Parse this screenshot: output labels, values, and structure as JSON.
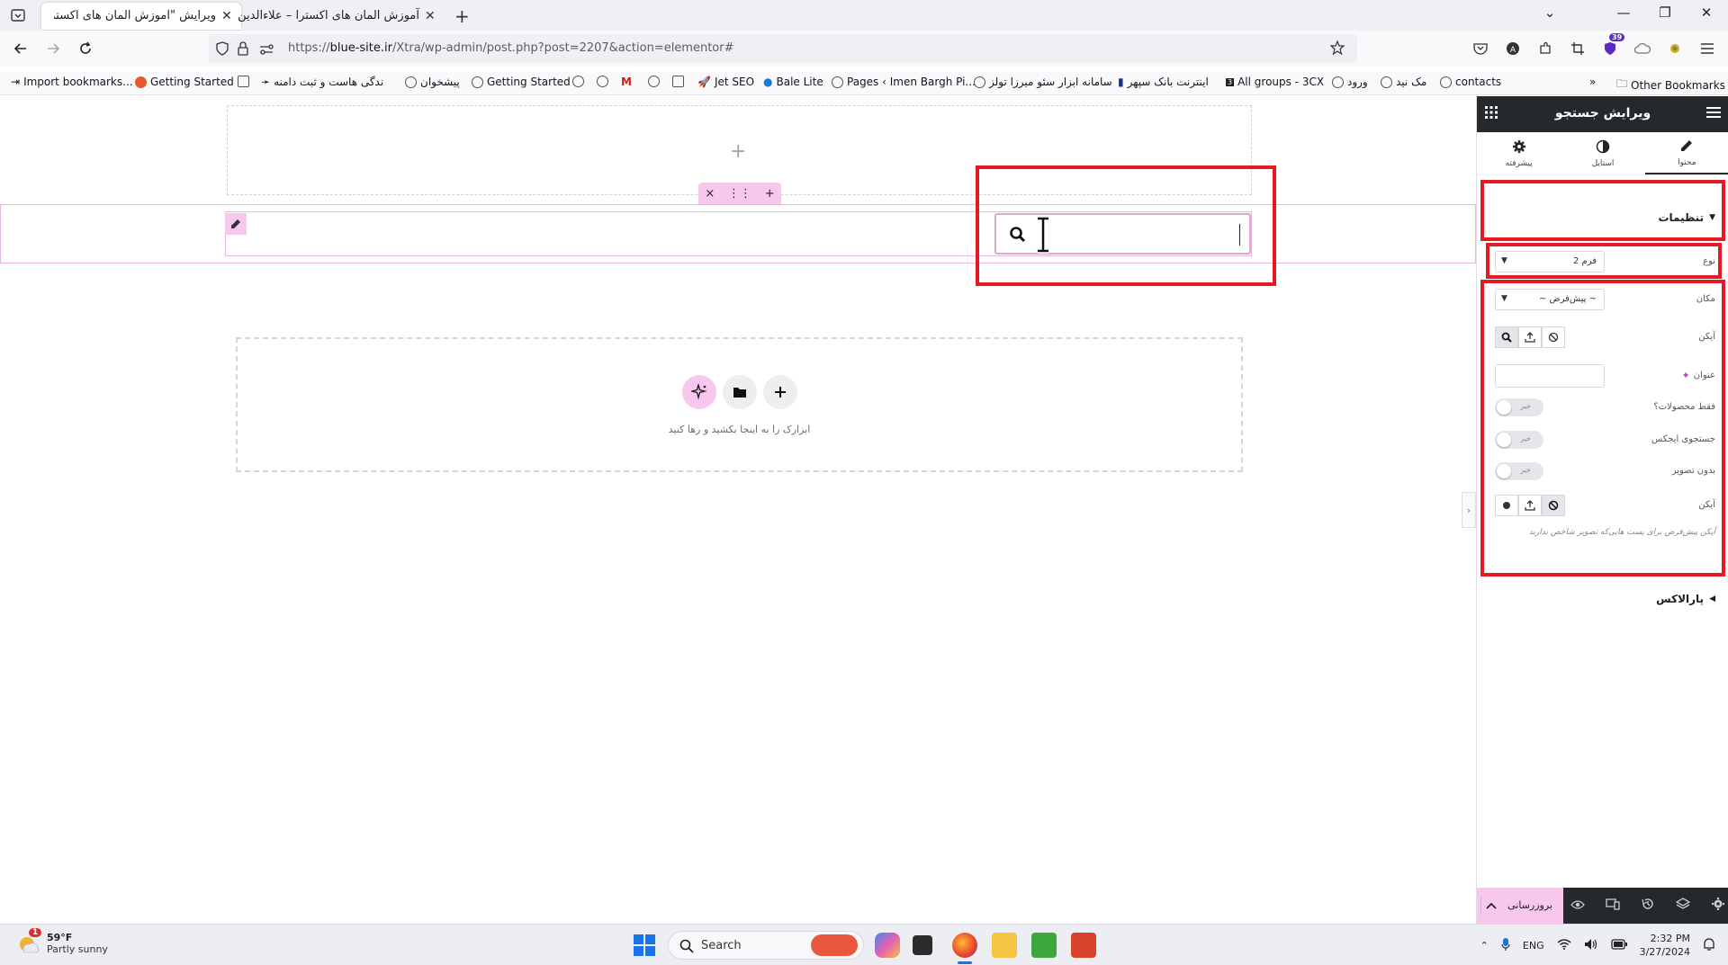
{
  "browser": {
    "tabs": [
      {
        "label": "ویرایش \"آموزش المان های اکسترا\" ‹ ع…",
        "active": true
      },
      {
        "label": "آموزش المان های اکسترا – علاءالدین",
        "active": false
      }
    ],
    "url_scheme": "https://",
    "url_host": "blue-site.ir",
    "url_path": "/Xtra/wp-admin/post.php?post=2207&action=elementor#",
    "extensions_badge": "39",
    "bookmarks": [
      "Import bookmarks...",
      "Getting Started",
      "ندگی هاست و ثبت دامنه",
      "پیشخوان",
      "Getting Started",
      "Jet SEO",
      "Bale Lite",
      "Pages ‹ Imen Bargh Pi...",
      "سامانه ابزار سئو میرزا تولز",
      "اینترنت بانک سپهر",
      "All groups - 3CX",
      "ورود",
      "مک نید",
      "contacts"
    ],
    "other_bookmarks": "Other Bookmarks"
  },
  "canvas": {
    "section_handle": {
      "close": "×",
      "move": "⋮⋮",
      "add": "+"
    },
    "empty_section_plus": "+",
    "drop_text": "ابزارک را به اینجا بکشید و رها کنید",
    "drop_buttons": [
      "ai-sparkle",
      "folder",
      "plus"
    ],
    "accent_color": "#f8c7ee",
    "highlight_color": "#e21b24"
  },
  "panel": {
    "title": "ویرایش جستجو",
    "tabs": [
      {
        "label": "محتوا",
        "icon": "pencil-icon",
        "active": true
      },
      {
        "label": "استایل",
        "icon": "contrast-icon",
        "active": false
      },
      {
        "label": "پیشرفته",
        "icon": "gear-icon",
        "active": false
      }
    ],
    "section_settings": "تنظیمات",
    "type_label": "نوع",
    "type_value": "فرم 2",
    "position_label": "مکان",
    "position_value": "~ پیش‌فرض ~",
    "icon_label": "آیکن",
    "title_label": "عنوان",
    "products_only_label": "فقط محصولات؟",
    "ajax_search_label": "جستجوی ایجکس",
    "no_image_label": "بدون تصویر",
    "icon2_label": "آیکن",
    "switch_off_text": "خیر",
    "icon2_desc": "آیکن پیش‌فرض برای پست هایی‌که تصویر شاخص ندارند",
    "section_parallax": "پارالاکس",
    "publish_label": "بروزرسانی"
  },
  "taskbar": {
    "temperature": "59°F",
    "weather": "Partly sunny",
    "weather_badge": "1",
    "search_label": "Search",
    "language": "ENG",
    "time": "2:32 PM",
    "date": "3/27/2024"
  }
}
